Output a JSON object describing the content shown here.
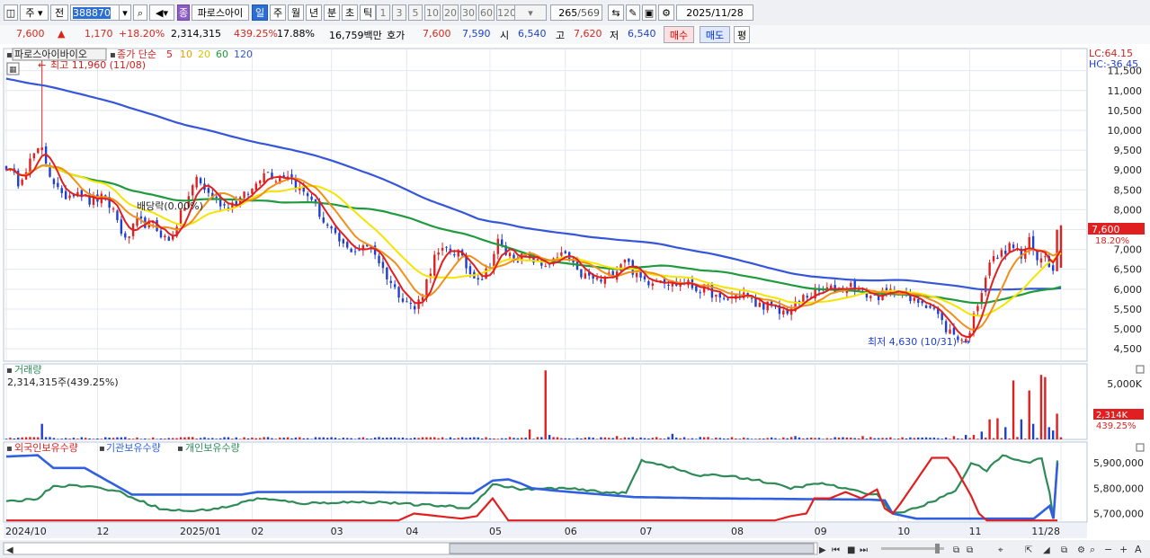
{
  "toolbar": {
    "market_label": "주",
    "code_prefix_label": "전",
    "stock_code": "388870",
    "badge_label": "종",
    "stock_name": "파로스아이",
    "period_tabs": [
      "일",
      "주",
      "월",
      "년",
      "분",
      "초",
      "틱"
    ],
    "active_period": "일",
    "minute_intervals": [
      "1",
      "3",
      "5",
      "10",
      "20",
      "30",
      "60",
      "120"
    ],
    "page_count": "265",
    "page_total": "/569",
    "date": "2025/11/28"
  },
  "quote": {
    "price": "7,600",
    "change_arrow": "▲",
    "change": "1,170",
    "change_pct": "+18.20%",
    "volume": "2,314,315",
    "volume_ratio": "439.25%",
    "turnover": "17.88%",
    "amount": "16,759백만",
    "bid_label": "호가",
    "ask_price": "7,600",
    "bid_price": "7,590",
    "open_label": "시",
    "open": "6,540",
    "high_label": "고",
    "high": "7,620",
    "low_label": "저",
    "low": "6,540",
    "buy_button": "매수",
    "sell_button": "매도",
    "eval_button": "평"
  },
  "colors": {
    "up": "#e02020",
    "down": "#1f3fd0",
    "ma5": "#e02020",
    "ma10": "#f0901a",
    "ma20": "#f5e400",
    "ma60": "#1f9a3c",
    "ma120": "#3556d8",
    "foreign": "#e02020",
    "institution": "#3060e0",
    "individual": "#2e8b57"
  },
  "chart_data": [
    {
      "type": "candlestick",
      "title": "파로스아이바이오",
      "legend": {
        "prefix": "종가 단순",
        "periods": [
          "5",
          "10",
          "20",
          "60",
          "120"
        ]
      },
      "indicators_top_right": [
        "LC:64.15",
        "HC:-36.45"
      ],
      "annotations": {
        "high_note": "최고 11,960 (11/08)",
        "low_note": "최저 4,630 (10/31)",
        "dividend_note": "배당락(0.00%)"
      },
      "current_price_label": "7,600",
      "current_pct_label": "18.20%",
      "ylim": [
        4300,
        11900
      ],
      "y_ticks": [
        {
          "v": 4500,
          "t": "4,500"
        },
        {
          "v": 5000,
          "t": "5,000"
        },
        {
          "v": 5500,
          "t": "5,500"
        },
        {
          "v": 6000,
          "t": "6,000"
        },
        {
          "v": 6500,
          "t": "6,500"
        },
        {
          "v": 7000,
          "t": "7,000"
        },
        {
          "v": 7500,
          "t": "7,500"
        },
        {
          "v": 8000,
          "t": "8,000"
        },
        {
          "v": 8500,
          "t": "8,500"
        },
        {
          "v": 9000,
          "t": "9,000"
        },
        {
          "v": 9500,
          "t": "9,500"
        },
        {
          "v": 10000,
          "t": "10,000"
        },
        {
          "v": 10500,
          "t": "10,500"
        },
        {
          "v": 11000,
          "t": "11,000"
        },
        {
          "v": 11500,
          "t": "11,500"
        }
      ],
      "x_labels": [
        {
          "i": 0,
          "t": "2024/10"
        },
        {
          "i": 23,
          "t": "12"
        },
        {
          "i": 44,
          "t": "2025/01"
        },
        {
          "i": 62,
          "t": "02"
        },
        {
          "i": 82,
          "t": "03"
        },
        {
          "i": 101,
          "t": "04"
        },
        {
          "i": 122,
          "t": "05"
        },
        {
          "i": 141,
          "t": "06"
        },
        {
          "i": 160,
          "t": "07"
        },
        {
          "i": 183,
          "t": "08"
        },
        {
          "i": 204,
          "t": "09"
        },
        {
          "i": 225,
          "t": "10"
        },
        {
          "i": 243,
          "t": "11"
        },
        {
          "i": 266,
          "t": "11/28"
        }
      ],
      "close_anchors": [
        [
          0,
          9100
        ],
        [
          3,
          8700
        ],
        [
          7,
          9400
        ],
        [
          9,
          9500
        ],
        [
          11,
          8900
        ],
        [
          14,
          8300
        ],
        [
          18,
          8500
        ],
        [
          21,
          8200
        ],
        [
          24,
          8300
        ],
        [
          27,
          8000
        ],
        [
          30,
          7200
        ],
        [
          33,
          7700
        ],
        [
          37,
          7600
        ],
        [
          41,
          7200
        ],
        [
          45,
          8100
        ],
        [
          48,
          8800
        ],
        [
          51,
          8400
        ],
        [
          55,
          8100
        ],
        [
          58,
          8200
        ],
        [
          62,
          8500
        ],
        [
          65,
          9000
        ],
        [
          68,
          8800
        ],
        [
          71,
          8900
        ],
        [
          74,
          8500
        ],
        [
          77,
          8300
        ],
        [
          80,
          7700
        ],
        [
          83,
          7300
        ],
        [
          86,
          7000
        ],
        [
          89,
          7000
        ],
        [
          92,
          7100
        ],
        [
          95,
          6500
        ],
        [
          98,
          6000
        ],
        [
          101,
          5700
        ],
        [
          103,
          5500
        ],
        [
          105,
          5900
        ],
        [
          108,
          6800
        ],
        [
          111,
          7000
        ],
        [
          114,
          6900
        ],
        [
          117,
          6400
        ],
        [
          120,
          6300
        ],
        [
          122,
          6600
        ],
        [
          124,
          7200
        ],
        [
          126,
          6900
        ],
        [
          129,
          6800
        ],
        [
          132,
          6800
        ],
        [
          135,
          6600
        ],
        [
          138,
          6700
        ],
        [
          141,
          6900
        ],
        [
          144,
          6400
        ],
        [
          147,
          6300
        ],
        [
          150,
          6200
        ],
        [
          153,
          6400
        ],
        [
          156,
          6800
        ],
        [
          159,
          6300
        ],
        [
          162,
          6200
        ],
        [
          165,
          6300
        ],
        [
          168,
          6100
        ],
        [
          171,
          6200
        ],
        [
          174,
          6000
        ],
        [
          177,
          6000
        ],
        [
          180,
          5700
        ],
        [
          183,
          5800
        ],
        [
          186,
          5900
        ],
        [
          189,
          5600
        ],
        [
          192,
          5600
        ],
        [
          195,
          5400
        ],
        [
          198,
          5500
        ],
        [
          201,
          5800
        ],
        [
          204,
          5900
        ],
        [
          207,
          6000
        ],
        [
          210,
          6000
        ],
        [
          213,
          6100
        ],
        [
          216,
          5900
        ],
        [
          219,
          5800
        ],
        [
          222,
          5900
        ],
        [
          225,
          6000
        ],
        [
          228,
          5700
        ],
        [
          231,
          5700
        ],
        [
          234,
          5500
        ],
        [
          237,
          5000
        ],
        [
          240,
          4800
        ],
        [
          242,
          4700
        ],
        [
          244,
          5300
        ],
        [
          246,
          6000
        ],
        [
          248,
          6700
        ],
        [
          250,
          6800
        ],
        [
          252,
          7000
        ],
        [
          254,
          7100
        ],
        [
          256,
          6800
        ],
        [
          258,
          7200
        ],
        [
          260,
          6700
        ],
        [
          262,
          6900
        ],
        [
          264,
          6430
        ],
        [
          265,
          7600
        ]
      ],
      "moving_averages": [
        5,
        10,
        20,
        60,
        120
      ],
      "ma120_start": 11300
    },
    {
      "type": "bar",
      "title": "거래량",
      "value_label": "2,314,315주(439.25%)",
      "y_ticks": [
        {
          "v": 5000,
          "t": "5,000K"
        }
      ],
      "current_label": "2,314K",
      "current_pct": "439.25%",
      "unit": "K",
      "max": 6300,
      "spikes": [
        [
          9,
          1400,
          0
        ],
        [
          132,
          900,
          1
        ],
        [
          136,
          6200,
          1
        ],
        [
          137,
          400,
          0
        ],
        [
          154,
          300,
          1
        ],
        [
          168,
          500,
          0
        ],
        [
          199,
          300,
          0
        ],
        [
          216,
          300,
          1
        ],
        [
          239,
          300,
          1
        ],
        [
          242,
          400,
          0
        ],
        [
          244,
          400,
          1
        ],
        [
          246,
          700,
          0
        ],
        [
          248,
          1800,
          1
        ],
        [
          250,
          1900,
          1
        ],
        [
          252,
          1100,
          0
        ],
        [
          254,
          5300,
          1
        ],
        [
          256,
          1800,
          0
        ],
        [
          258,
          4400,
          1
        ],
        [
          259,
          1400,
          0
        ],
        [
          261,
          5800,
          1
        ],
        [
          262,
          5600,
          1
        ],
        [
          263,
          1100,
          0
        ],
        [
          264,
          800,
          0
        ],
        [
          265,
          2314,
          1
        ]
      ]
    },
    {
      "type": "line",
      "series_names": [
        "외국인보유수량",
        "기관보유수량",
        "개인보유수량"
      ],
      "y_ticks": [
        {
          "v": 5700000,
          "t": "5,700,000"
        },
        {
          "v": 5800000,
          "t": "5,800,000"
        },
        {
          "v": 5900000,
          "t": "5,900,000"
        }
      ],
      "ylim": [
        5670000,
        5950000
      ],
      "institution_anchors": [
        [
          0,
          5925000
        ],
        [
          8,
          5930000
        ],
        [
          12,
          5880000
        ],
        [
          20,
          5880000
        ],
        [
          32,
          5775000
        ],
        [
          60,
          5775000
        ],
        [
          64,
          5785000
        ],
        [
          90,
          5785000
        ],
        [
          119,
          5780000
        ],
        [
          124,
          5830000
        ],
        [
          128,
          5835000
        ],
        [
          131,
          5820000
        ],
        [
          134,
          5800000
        ],
        [
          140,
          5790000
        ],
        [
          160,
          5765000
        ],
        [
          180,
          5760000
        ],
        [
          220,
          5755000
        ],
        [
          224,
          5752000
        ],
        [
          226,
          5700000
        ],
        [
          232,
          5680000
        ],
        [
          244,
          5680000
        ],
        [
          262,
          5680000
        ],
        [
          266,
          5730000
        ],
        [
          267,
          5680000
        ],
        [
          268,
          5900000
        ]
      ],
      "individual_anchors": [
        [
          0,
          5745000
        ],
        [
          8,
          5760000
        ],
        [
          12,
          5810000
        ],
        [
          20,
          5810000
        ],
        [
          28,
          5790000
        ],
        [
          40,
          5715000
        ],
        [
          48,
          5710000
        ],
        [
          56,
          5725000
        ],
        [
          64,
          5760000
        ],
        [
          76,
          5740000
        ],
        [
          86,
          5745000
        ],
        [
          96,
          5745000
        ],
        [
          104,
          5735000
        ],
        [
          112,
          5730000
        ],
        [
          118,
          5720000
        ],
        [
          124,
          5815000
        ],
        [
          132,
          5795000
        ],
        [
          142,
          5800000
        ],
        [
          152,
          5785000
        ],
        [
          158,
          5780000
        ],
        [
          162,
          5910000
        ],
        [
          168,
          5890000
        ],
        [
          176,
          5850000
        ],
        [
          184,
          5850000
        ],
        [
          192,
          5830000
        ],
        [
          200,
          5800000
        ],
        [
          208,
          5820000
        ],
        [
          216,
          5790000
        ],
        [
          222,
          5775000
        ],
        [
          226,
          5700000
        ],
        [
          232,
          5720000
        ],
        [
          238,
          5760000
        ],
        [
          242,
          5790000
        ],
        [
          246,
          5900000
        ],
        [
          250,
          5870000
        ],
        [
          254,
          5930000
        ],
        [
          260,
          5900000
        ],
        [
          264,
          5920000
        ],
        [
          266,
          5780000
        ],
        [
          267,
          5680000
        ],
        [
          268,
          5910000
        ]
      ],
      "foreign_anchors": [
        [
          0,
          5673000
        ],
        [
          100,
          5673000
        ],
        [
          104,
          5700000
        ],
        [
          110,
          5690000
        ],
        [
          116,
          5680000
        ],
        [
          120,
          5690000
        ],
        [
          124,
          5760000
        ],
        [
          128,
          5673000
        ],
        [
          196,
          5673000
        ],
        [
          200,
          5690000
        ],
        [
          204,
          5700000
        ],
        [
          206,
          5760000
        ],
        [
          210,
          5760000
        ],
        [
          214,
          5785000
        ],
        [
          218,
          5760000
        ],
        [
          222,
          5795000
        ],
        [
          224,
          5720000
        ],
        [
          226,
          5700000
        ],
        [
          228,
          5740000
        ],
        [
          232,
          5830000
        ],
        [
          236,
          5920000
        ],
        [
          240,
          5920000
        ],
        [
          242,
          5880000
        ],
        [
          246,
          5770000
        ],
        [
          248,
          5700000
        ],
        [
          250,
          5673000
        ],
        [
          268,
          5673000
        ]
      ]
    }
  ]
}
